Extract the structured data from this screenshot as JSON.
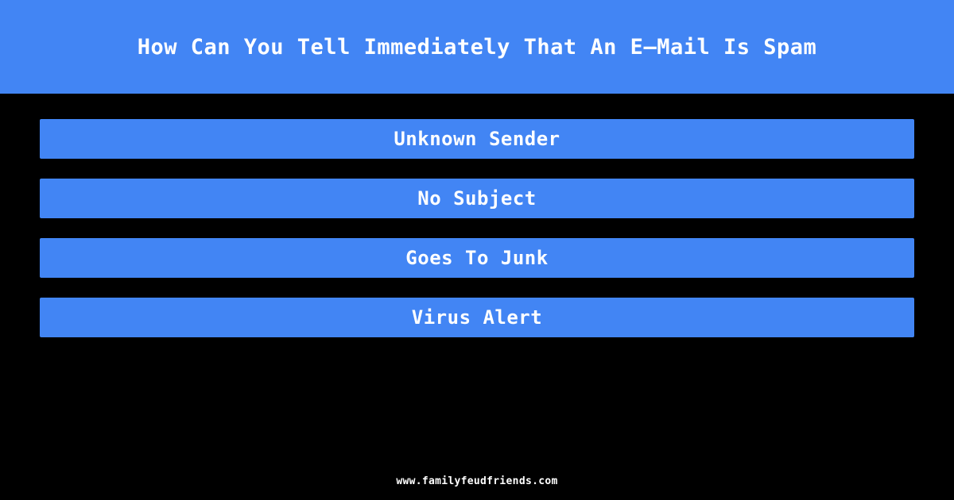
{
  "theme": {
    "background_color": "#000000",
    "accent_color": "#4285f4",
    "text_color": "#ffffff"
  },
  "header": {
    "title": "How Can You Tell Immediately That An E–Mail Is Spam"
  },
  "board": {
    "answers": [
      {
        "label": "Unknown Sender"
      },
      {
        "label": "No Subject"
      },
      {
        "label": "Goes To Junk"
      },
      {
        "label": "Virus Alert"
      }
    ]
  },
  "footer": {
    "url": "www.familyfeudfriends.com"
  }
}
